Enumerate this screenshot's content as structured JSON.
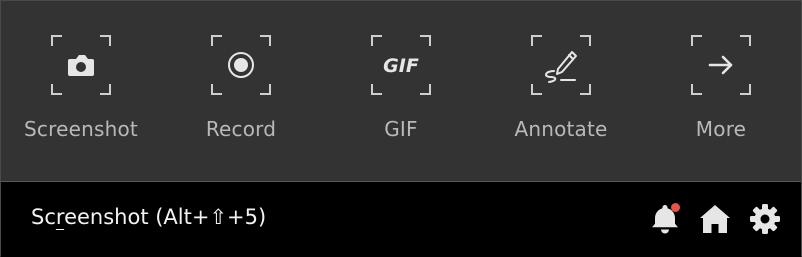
{
  "tools": [
    {
      "label": "Screenshot",
      "icon": "camera-icon"
    },
    {
      "label": "Record",
      "icon": "record-icon"
    },
    {
      "label": "GIF",
      "icon": "gif-icon",
      "glyph": "GIF"
    },
    {
      "label": "Annotate",
      "icon": "pen-icon"
    },
    {
      "label": "More",
      "icon": "arrow-right-icon"
    }
  ],
  "footer": {
    "title_pre": "Sc",
    "title_u": "r",
    "title_post": "eenshot (Alt+⇧+5)",
    "notification_color": "#e5534b"
  },
  "colors": {
    "panel_bg": "#333333",
    "footer_bg": "#000000",
    "icon_color": "#cfcfcf",
    "label_color": "#b9b9b9"
  }
}
